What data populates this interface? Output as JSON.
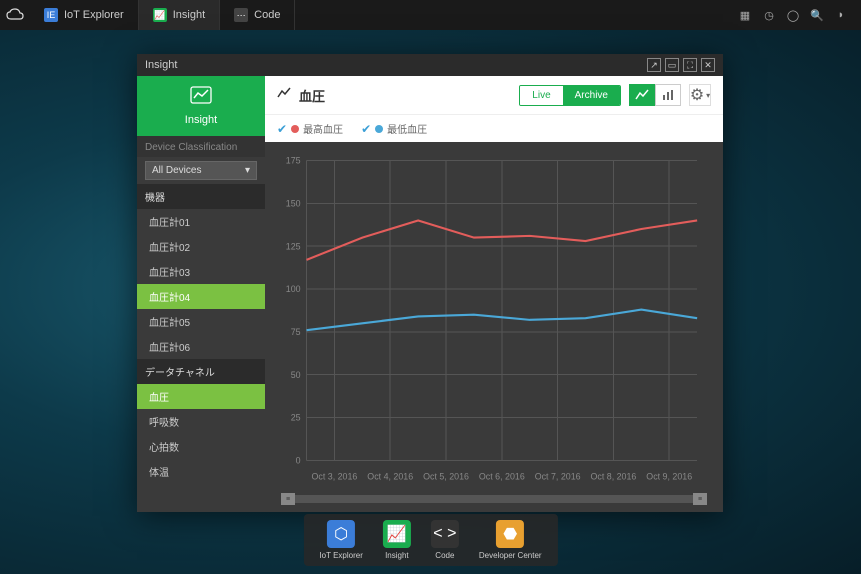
{
  "topbar": {
    "tabs": [
      {
        "label": "IoT Explorer",
        "active": false,
        "icon_bg": "#3b7dd8",
        "icon_glyph": "IE"
      },
      {
        "label": "Insight",
        "active": true,
        "icon_bg": "#1aad4e",
        "icon_glyph": "📈"
      },
      {
        "label": "Code",
        "active": false,
        "icon_bg": "#444",
        "icon_glyph": "⋯"
      }
    ]
  },
  "window": {
    "title": "Insight"
  },
  "sidebar": {
    "insight_label": "Insight",
    "classification_label": "Device Classification",
    "device_select": "All Devices",
    "devices_header": "機器",
    "devices": [
      {
        "label": "血圧計01",
        "active": false
      },
      {
        "label": "血圧計02",
        "active": false
      },
      {
        "label": "血圧計03",
        "active": false
      },
      {
        "label": "血圧計04",
        "active": true
      },
      {
        "label": "血圧計05",
        "active": false
      },
      {
        "label": "血圧計06",
        "active": false
      }
    ],
    "channels_header": "データチャネル",
    "channels": [
      {
        "label": "血圧",
        "active": true
      },
      {
        "label": "呼吸数",
        "active": false
      },
      {
        "label": "心拍数",
        "active": false
      },
      {
        "label": "体温",
        "active": false
      }
    ]
  },
  "content": {
    "title": "血圧",
    "mode_live": "Live",
    "mode_archive": "Archive",
    "mode_selected": "Archive",
    "legend": [
      {
        "label": "最高血圧",
        "color": "#e35d5b"
      },
      {
        "label": "最低血圧",
        "color": "#4aa8d8"
      }
    ]
  },
  "chart_data": {
    "type": "line",
    "xlabel": "",
    "ylabel": "",
    "ylim": [
      0,
      175
    ],
    "y_ticks": [
      0,
      25,
      50,
      75,
      100,
      125,
      150,
      175
    ],
    "categories": [
      "Oct 3, 2016",
      "Oct 4, 2016",
      "Oct 5, 2016",
      "Oct 6, 2016",
      "Oct 7, 2016",
      "Oct 8, 2016",
      "Oct 9, 2016"
    ],
    "series": [
      {
        "name": "最高血圧",
        "color": "#e35d5b",
        "values": [
          117,
          130,
          140,
          130,
          131,
          128,
          135,
          140
        ]
      },
      {
        "name": "最低血圧",
        "color": "#4aa8d8",
        "values": [
          76,
          80,
          84,
          85,
          82,
          83,
          88,
          83
        ]
      }
    ]
  },
  "dock": {
    "items": [
      {
        "label": "IoT Explorer",
        "bg": "#3b7dd8",
        "glyph": "⬡"
      },
      {
        "label": "Insight",
        "bg": "#1aad4e",
        "glyph": "📈"
      },
      {
        "label": "Code",
        "bg": "#333",
        "glyph": "< >"
      },
      {
        "label": "Developer Center",
        "bg": "#e8a030",
        "glyph": "⬣"
      }
    ]
  }
}
